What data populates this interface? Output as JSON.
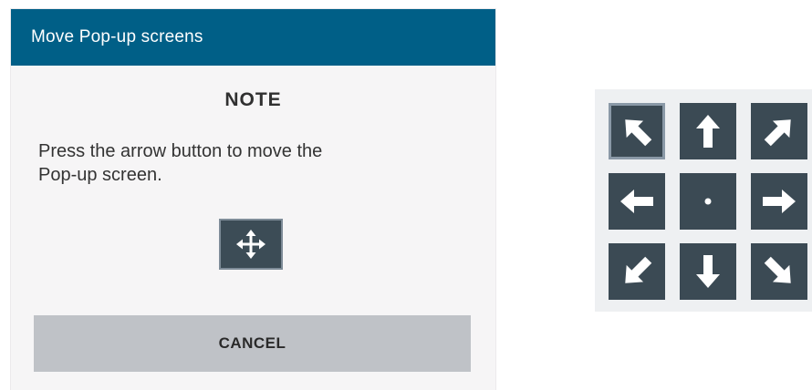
{
  "dialog": {
    "title": "Move Pop-up screens",
    "heading": "NOTE",
    "message": "Press the arrow button to move the\nPop-up screen.",
    "move_icon": "move-arrows-icon",
    "cancel_label": "CANCEL"
  },
  "arrow_pad": {
    "buttons": [
      {
        "name": "up-left",
        "icon": "arrow-up-left-icon",
        "active": true
      },
      {
        "name": "up",
        "icon": "arrow-up-icon",
        "active": false
      },
      {
        "name": "up-right",
        "icon": "arrow-up-right-icon",
        "active": false
      },
      {
        "name": "left",
        "icon": "arrow-left-icon",
        "active": false
      },
      {
        "name": "center",
        "icon": "center-dot-icon",
        "active": false
      },
      {
        "name": "right",
        "icon": "arrow-right-icon",
        "active": false
      },
      {
        "name": "down-left",
        "icon": "arrow-down-left-icon",
        "active": false
      },
      {
        "name": "down",
        "icon": "arrow-down-icon",
        "active": false
      },
      {
        "name": "down-right",
        "icon": "arrow-down-right-icon",
        "active": false
      }
    ]
  },
  "colors": {
    "header": "#005f87",
    "button_dark": "#3b4a54",
    "cancel_bg": "#bfc2c7"
  }
}
